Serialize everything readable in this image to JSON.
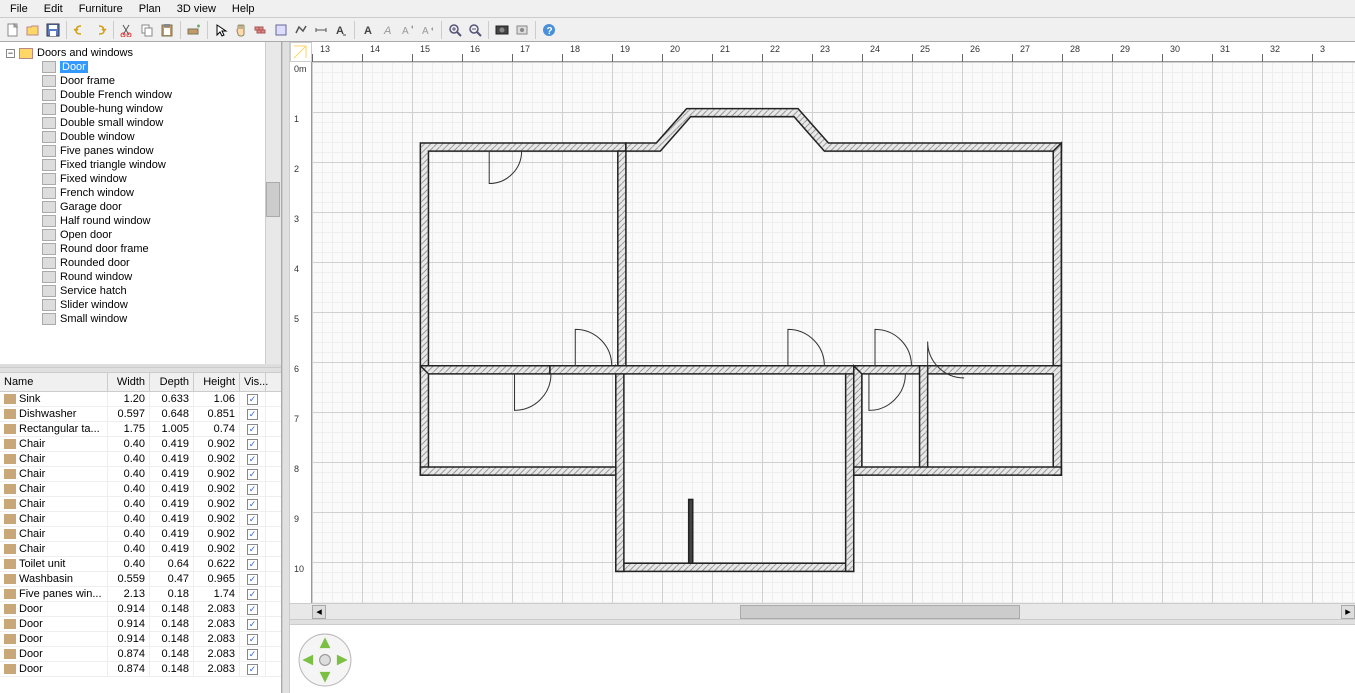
{
  "menu": [
    "File",
    "Edit",
    "Furniture",
    "Plan",
    "3D view",
    "Help"
  ],
  "catalog": {
    "folder": "Doors and windows",
    "items": [
      "Door",
      "Door frame",
      "Double French window",
      "Double-hung window",
      "Double small window",
      "Double window",
      "Five panes window",
      "Fixed triangle window",
      "Fixed window",
      "French window",
      "Garage door",
      "Half round window",
      "Open door",
      "Round door frame",
      "Rounded door",
      "Round window",
      "Service hatch",
      "Slider window",
      "Small window"
    ],
    "selected": "Door"
  },
  "furniture": {
    "headers": {
      "name": "Name",
      "width": "Width",
      "depth": "Depth",
      "height": "Height",
      "vis": "Vis..."
    },
    "rows": [
      {
        "name": "Sink",
        "w": "1.20",
        "d": "0.633",
        "h": "1.06",
        "v": true
      },
      {
        "name": "Dishwasher",
        "w": "0.597",
        "d": "0.648",
        "h": "0.851",
        "v": true
      },
      {
        "name": "Rectangular ta...",
        "w": "1.75",
        "d": "1.005",
        "h": "0.74",
        "v": true
      },
      {
        "name": "Chair",
        "w": "0.40",
        "d": "0.419",
        "h": "0.902",
        "v": true
      },
      {
        "name": "Chair",
        "w": "0.40",
        "d": "0.419",
        "h": "0.902",
        "v": true
      },
      {
        "name": "Chair",
        "w": "0.40",
        "d": "0.419",
        "h": "0.902",
        "v": true
      },
      {
        "name": "Chair",
        "w": "0.40",
        "d": "0.419",
        "h": "0.902",
        "v": true
      },
      {
        "name": "Chair",
        "w": "0.40",
        "d": "0.419",
        "h": "0.902",
        "v": true
      },
      {
        "name": "Chair",
        "w": "0.40",
        "d": "0.419",
        "h": "0.902",
        "v": true
      },
      {
        "name": "Chair",
        "w": "0.40",
        "d": "0.419",
        "h": "0.902",
        "v": true
      },
      {
        "name": "Chair",
        "w": "0.40",
        "d": "0.419",
        "h": "0.902",
        "v": true
      },
      {
        "name": "Toilet unit",
        "w": "0.40",
        "d": "0.64",
        "h": "0.622",
        "v": true
      },
      {
        "name": "Washbasin",
        "w": "0.559",
        "d": "0.47",
        "h": "0.965",
        "v": true
      },
      {
        "name": "Five panes win...",
        "w": "2.13",
        "d": "0.18",
        "h": "1.74",
        "v": true
      },
      {
        "name": "Door",
        "w": "0.914",
        "d": "0.148",
        "h": "2.083",
        "v": true
      },
      {
        "name": "Door",
        "w": "0.914",
        "d": "0.148",
        "h": "2.083",
        "v": true
      },
      {
        "name": "Door",
        "w": "0.914",
        "d": "0.148",
        "h": "2.083",
        "v": true
      },
      {
        "name": "Door",
        "w": "0.874",
        "d": "0.148",
        "h": "2.083",
        "v": true
      },
      {
        "name": "Door",
        "w": "0.874",
        "d": "0.148",
        "h": "2.083",
        "v": true
      }
    ]
  },
  "ruler": {
    "h": [
      "13",
      "14",
      "15",
      "16",
      "17",
      "18",
      "19",
      "20",
      "21",
      "22",
      "23",
      "24",
      "25",
      "26",
      "27",
      "28",
      "29",
      "30",
      "31",
      "32",
      "3"
    ],
    "v": [
      "0m",
      "1",
      "2",
      "3",
      "4",
      "5",
      "6",
      "7",
      "8",
      "9",
      "10"
    ]
  }
}
